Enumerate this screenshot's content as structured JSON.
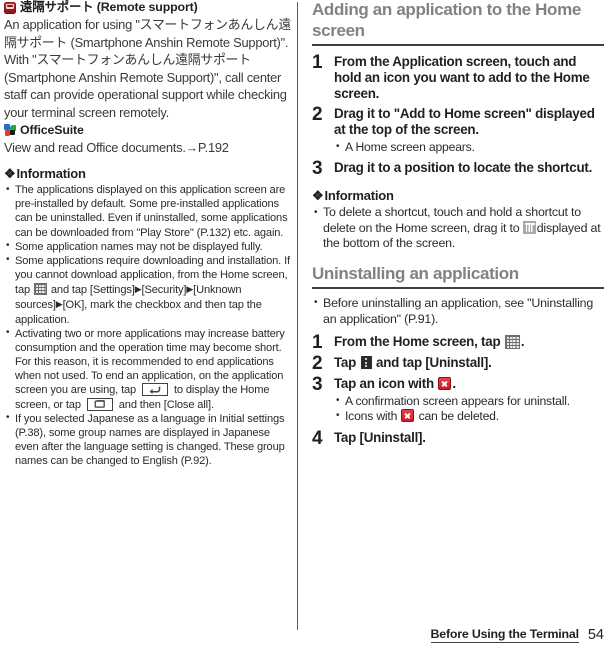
{
  "left_column": {
    "apps": [
      {
        "icon": "remote-support-app-icon",
        "name": "遠隔サポート (Remote support)",
        "description": "An application for using \"スマートフォンあんしん遠隔サポート (Smartphone Anshin Remote Support)\". With \"スマートフォンあんしん遠隔サポート (Smartphone Anshin Remote Support)\", call center staff can provide operational support while checking your terminal screen remotely."
      },
      {
        "icon": "officesuite-app-icon",
        "name": "OfficeSuite",
        "description": "View and read Office documents.",
        "page_ref": "P.192"
      }
    ],
    "information": {
      "heading": "Information",
      "diamond": "❖",
      "bullets": [
        {
          "parts": [
            {
              "t": "text",
              "v": "The applications displayed on this application screen are pre-installed by default. Some pre-installed applications can be uninstalled. Even if uninstalled, some applications can be downloaded from \"Play Store\" (P.132) etc. again."
            }
          ]
        },
        {
          "parts": [
            {
              "t": "text",
              "v": "Some application names may not be displayed fully."
            }
          ]
        },
        {
          "parts": [
            {
              "t": "text",
              "v": "Some applications require downloading and installation. If you cannot download application, from the Home screen, tap "
            },
            {
              "t": "icon",
              "v": "app-drawer-grid-icon"
            },
            {
              "t": "text",
              "v": " and tap [Settings]"
            },
            {
              "t": "tri",
              "v": "▶"
            },
            {
              "t": "text",
              "v": "[Security]"
            },
            {
              "t": "tri",
              "v": "▶"
            },
            {
              "t": "text",
              "v": "[Unknown sources]"
            },
            {
              "t": "tri",
              "v": "▶"
            },
            {
              "t": "text",
              "v": "[OK], mark the checkbox and then tap the application."
            }
          ]
        },
        {
          "parts": [
            {
              "t": "text",
              "v": "Activating two or more applications may increase battery consumption and the operation time may become short. For this reason, it is recommended to end applications when not used. To end an application, on the application screen you are using, tap "
            },
            {
              "t": "icon",
              "v": "back-key-icon"
            },
            {
              "t": "text",
              "v": " to display the Home screen, or tap "
            },
            {
              "t": "icon",
              "v": "recent-apps-key-icon"
            },
            {
              "t": "text",
              "v": " and then [Close all]."
            }
          ]
        },
        {
          "parts": [
            {
              "t": "text",
              "v": "If you selected Japanese as a language in Initial settings (P.38), some group names are displayed in Japanese even after the language setting is changed. These group names can be changed to English (P.92)."
            }
          ]
        }
      ]
    }
  },
  "right_column": {
    "section1": {
      "heading": "Adding an application to the Home screen",
      "steps": [
        {
          "num": "1",
          "text": "From the Application screen, touch and hold an icon you want to add to the Home screen.",
          "sub": []
        },
        {
          "num": "2",
          "text": "Drag it to \"Add to Home screen\" displayed at the top of the screen.",
          "sub": [
            "A Home screen appears."
          ]
        },
        {
          "num": "3",
          "text": "Drag it to a position to locate the shortcut.",
          "sub": []
        }
      ],
      "information": {
        "heading": "Information",
        "diamond": "❖",
        "bullet_parts": [
          {
            "t": "text",
            "v": "To delete a shortcut, touch and hold a shortcut to delete on the Home screen, drag it to "
          },
          {
            "t": "icon",
            "v": "trash-icon"
          },
          {
            "t": "text",
            "v": "displayed at the bottom of the screen."
          }
        ]
      }
    },
    "section2": {
      "heading": "Uninstalling an application",
      "lead_bullet": "Before uninstalling an application, see \"Uninstalling an application\" (P.91).",
      "steps": [
        {
          "num": "1",
          "parts": [
            {
              "t": "text",
              "v": "From the Home screen, tap "
            },
            {
              "t": "icon",
              "v": "app-drawer-grid-icon"
            },
            {
              "t": "text",
              "v": "."
            }
          ],
          "sub": []
        },
        {
          "num": "2",
          "parts": [
            {
              "t": "text",
              "v": "Tap "
            },
            {
              "t": "icon",
              "v": "overflow-menu-icon"
            },
            {
              "t": "text",
              "v": " and tap [Uninstall]."
            }
          ],
          "sub": []
        },
        {
          "num": "3",
          "parts": [
            {
              "t": "text",
              "v": "Tap an icon with "
            },
            {
              "t": "icon",
              "v": "delete-x-icon"
            },
            {
              "t": "text",
              "v": "."
            }
          ],
          "sub": [
            {
              "parts": [
                {
                  "t": "text",
                  "v": "A confirmation screen appears for uninstall."
                }
              ]
            },
            {
              "parts": [
                {
                  "t": "text",
                  "v": "Icons with "
                },
                {
                  "t": "icon",
                  "v": "delete-x-icon"
                },
                {
                  "t": "text",
                  "v": " can be deleted."
                }
              ]
            }
          ]
        },
        {
          "num": "4",
          "parts": [
            {
              "t": "text",
              "v": "Tap [Uninstall]."
            }
          ],
          "sub": []
        }
      ]
    }
  },
  "footer": {
    "chapter_title": "Before Using the Terminal",
    "page_number": "54"
  },
  "colors": {
    "heading_gray": "#808285",
    "rule_dark": "#414042",
    "body_text": "#231f20",
    "delete_red": "#cf1a2b"
  }
}
